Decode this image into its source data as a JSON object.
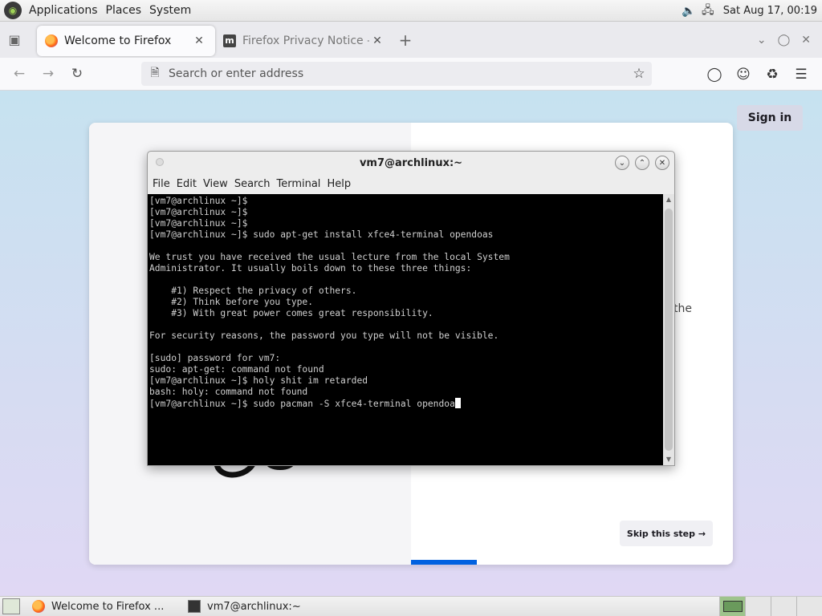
{
  "desktop": {
    "menu": [
      "Applications",
      "Places",
      "System"
    ],
    "clock": "Sat Aug 17, 00:19",
    "tray_icons": [
      "volume-icon",
      "network-icon"
    ]
  },
  "browser": {
    "tabs": [
      {
        "title": "Welcome to Firefox",
        "active": true
      },
      {
        "title": "Firefox Privacy Notice — M...",
        "active": false
      }
    ],
    "url_placeholder": "Search or enter address",
    "page": {
      "sign_in": "Sign in",
      "peek_text": "the",
      "skip": "Skip this step →"
    }
  },
  "terminal": {
    "title": "vm7@archlinux:~",
    "menu": [
      "File",
      "Edit",
      "View",
      "Search",
      "Terminal",
      "Help"
    ],
    "lines": [
      "[vm7@archlinux ~]$",
      "[vm7@archlinux ~]$",
      "[vm7@archlinux ~]$",
      "[vm7@archlinux ~]$ sudo apt-get install xfce4-terminal opendoas",
      "",
      "We trust you have received the usual lecture from the local System",
      "Administrator. It usually boils down to these three things:",
      "",
      "    #1) Respect the privacy of others.",
      "    #2) Think before you type.",
      "    #3) With great power comes great responsibility.",
      "",
      "For security reasons, the password you type will not be visible.",
      "",
      "[sudo] password for vm7:",
      "sudo: apt-get: command not found",
      "[vm7@archlinux ~]$ holy shit im retarded",
      "bash: holy: command not found"
    ],
    "current_line": "[vm7@archlinux ~]$ sudo pacman -S xfce4-terminal opendoa"
  },
  "taskbar": {
    "items": [
      {
        "label": "Welcome to Firefox ..."
      },
      {
        "label": "vm7@archlinux:~"
      }
    ]
  }
}
